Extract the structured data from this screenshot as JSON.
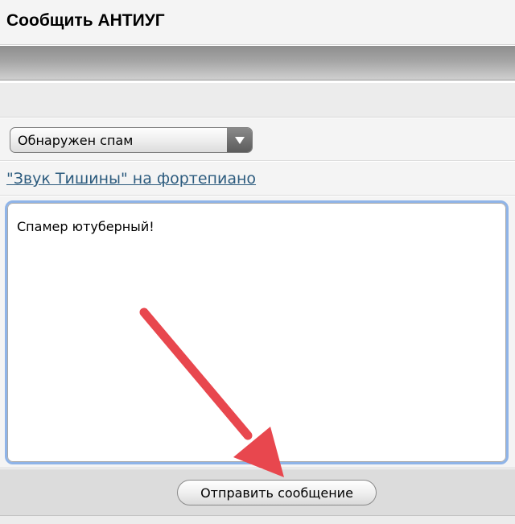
{
  "header": {
    "title": "Сообщить АНТИУГ"
  },
  "report_form": {
    "reason_select": {
      "selected": "Обнаружен спам"
    },
    "target_link": {
      "text": "\"Звук Тишины\" на фортепиано"
    },
    "message": {
      "value": "Спамер ютуберный!"
    },
    "submit_label": "Отправить сообщение"
  },
  "colors": {
    "link": "#2c5b7e",
    "textarea_focus": "#8fb4e8",
    "annotation_arrow": "#e8474e"
  },
  "icons": {
    "select_arrow": "chevron-down-icon",
    "annotation": "red-arrow-icon"
  }
}
